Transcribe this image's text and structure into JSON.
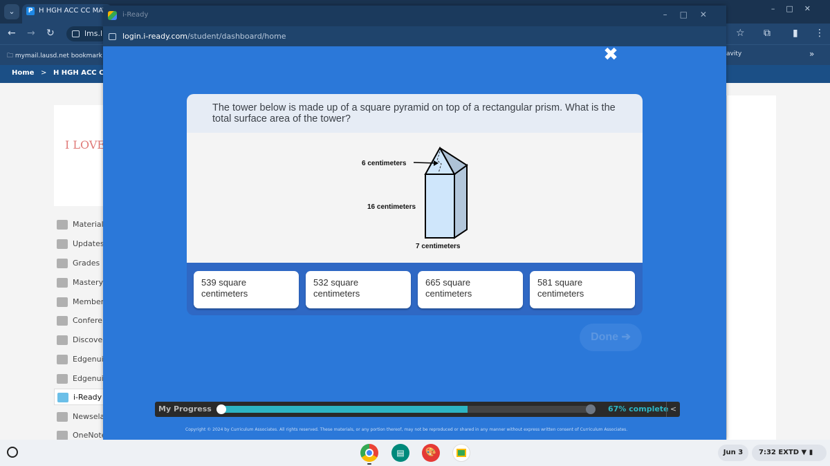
{
  "background_browser": {
    "tab_title": "H HGH ACC CC MATH",
    "url_fragment": "lms.l",
    "bookmark_left": "mymail.lausd.net bookmark",
    "bookmark_right": "avity",
    "breadcrumb_home": "Home",
    "breadcrumb_sep": ">",
    "breadcrumb_course": "H HGH ACC CC M",
    "logo_text": "I LOVE"
  },
  "sidebar": {
    "items": [
      {
        "label": "Materials"
      },
      {
        "label": "Updates"
      },
      {
        "label": "Grades"
      },
      {
        "label": "Mastery"
      },
      {
        "label": "Members"
      },
      {
        "label": "Conferences"
      },
      {
        "label": "Discover"
      },
      {
        "label": "Edgenuity"
      },
      {
        "label": "Edgenuity"
      },
      {
        "label": "i-Ready"
      },
      {
        "label": "Newsela"
      },
      {
        "label": "OneNote"
      }
    ]
  },
  "iready_window": {
    "title": "i-Ready",
    "url_host": "login.i-ready.com",
    "url_path": "/student/dashboard/home"
  },
  "question": {
    "text": "The tower below is made up of a square pyramid on top of a rectangular prism. What is the total surface area of the tower?",
    "figure_labels": {
      "slant": "6 centimeters",
      "height": "16 centimeters",
      "base": "7 centimeters"
    }
  },
  "answers": [
    {
      "label": "539 square centimeters"
    },
    {
      "label": "532 square centimeters"
    },
    {
      "label": "665 square centimeters"
    },
    {
      "label": "581 square centimeters"
    }
  ],
  "done_label": "Done",
  "progress": {
    "label": "My Progress",
    "percent": 67,
    "percent_text": "67% complete",
    "toggle": "<"
  },
  "copyright": "Copyright © 2024 by Curriculum Associates. All rights reserved. These materials, or any portion thereof, may not be reproduced or shared in any manner without express written consent of Curriculum Associates.",
  "shelf": {
    "date": "Jun 3",
    "time": "7:32",
    "extd": "EXTD"
  },
  "colors": {
    "iready_blue": "#2b78d9",
    "progress_teal": "#2cb5c4"
  }
}
